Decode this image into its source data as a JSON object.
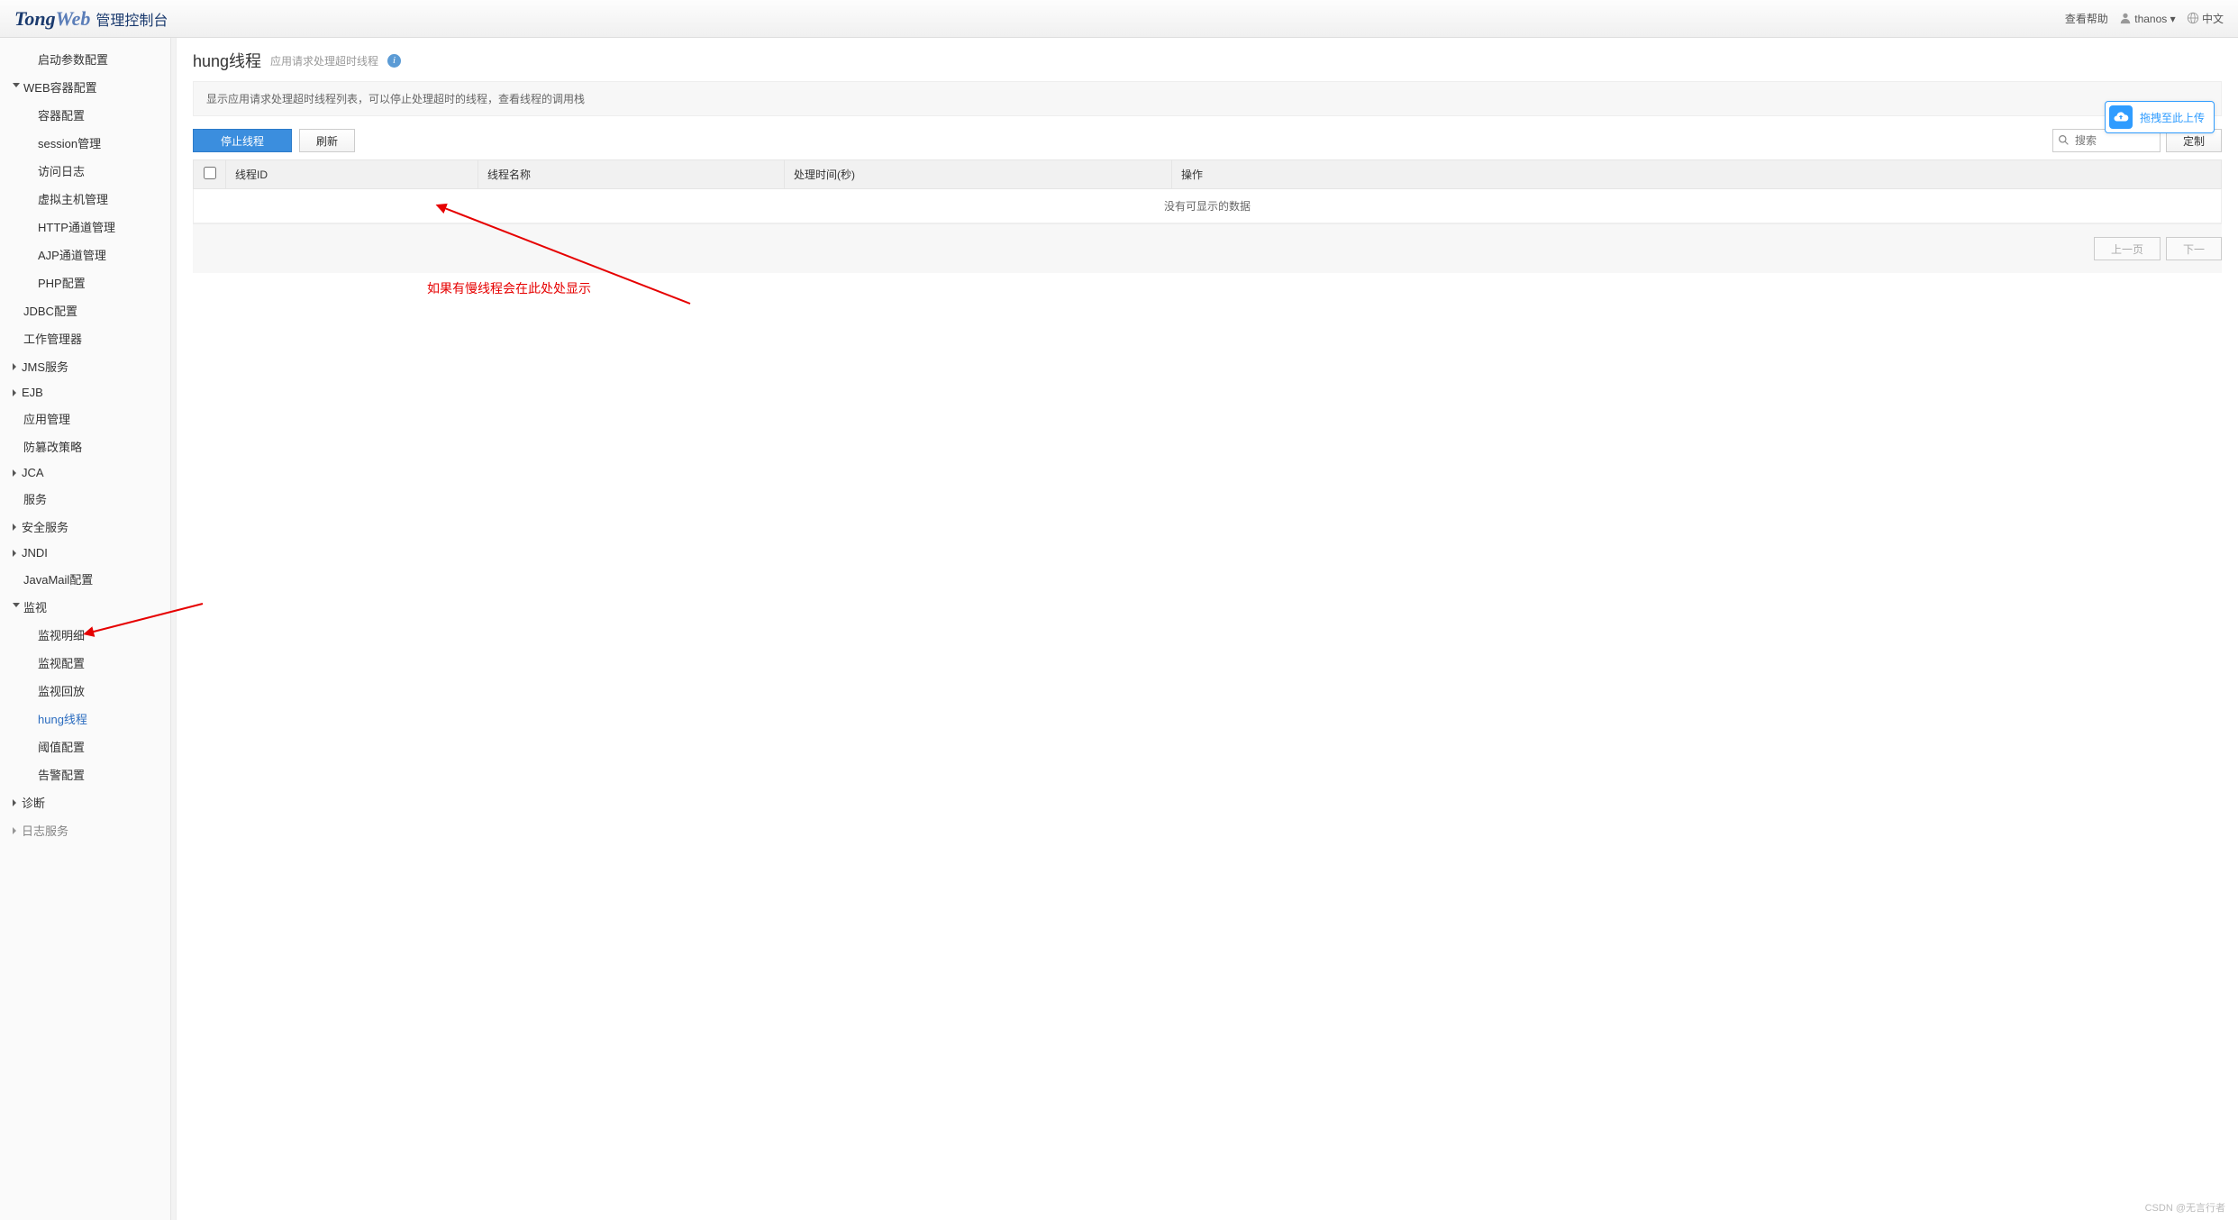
{
  "topbar": {
    "logo_part1": "Tong",
    "logo_part2": "Web",
    "logo_sub": "管理控制台",
    "help": "查看帮助",
    "user": "thanos",
    "lang": "中文"
  },
  "sidebar": [
    {
      "label": "启动参数配置",
      "level": 1
    },
    {
      "label": "WEB容器配置",
      "level": 0,
      "caret": "open"
    },
    {
      "label": "容器配置",
      "level": 1
    },
    {
      "label": "session管理",
      "level": 1
    },
    {
      "label": "访问日志",
      "level": 1
    },
    {
      "label": "虚拟主机管理",
      "level": 1
    },
    {
      "label": "HTTP通道管理",
      "level": 1
    },
    {
      "label": "AJP通道管理",
      "level": 1
    },
    {
      "label": "PHP配置",
      "level": 1
    },
    {
      "label": "JDBC配置",
      "level": 0
    },
    {
      "label": "工作管理器",
      "level": 0
    },
    {
      "label": "JMS服务",
      "level": 0,
      "caret": "closed"
    },
    {
      "label": "EJB",
      "level": 0,
      "caret": "closed"
    },
    {
      "label": "应用管理",
      "level": 0
    },
    {
      "label": "防篡改策略",
      "level": 0
    },
    {
      "label": "JCA",
      "level": 0,
      "caret": "closed"
    },
    {
      "label": "服务",
      "level": 0
    },
    {
      "label": "安全服务",
      "level": 0,
      "caret": "closed"
    },
    {
      "label": "JNDI",
      "level": 0,
      "caret": "closed"
    },
    {
      "label": "JavaMail配置",
      "level": 0
    },
    {
      "label": "监视",
      "level": 0,
      "caret": "open"
    },
    {
      "label": "监视明细",
      "level": 1
    },
    {
      "label": "监视配置",
      "level": 1
    },
    {
      "label": "监视回放",
      "level": 1
    },
    {
      "label": "hung线程",
      "level": 1,
      "active": true
    },
    {
      "label": "阈值配置",
      "level": 1
    },
    {
      "label": "告警配置",
      "level": 1
    },
    {
      "label": "诊断",
      "level": 0,
      "caret": "closed"
    },
    {
      "label": "日志服务",
      "level": 0,
      "caret": "closed",
      "truncated": true
    }
  ],
  "page": {
    "title": "hung线程",
    "subtitle": "应用请求处理超时线程",
    "description": "显示应用请求处理超时线程列表，可以停止处理超时的线程，查看线程的调用栈"
  },
  "toolbar": {
    "stop": "停止线程",
    "refresh": "刷新",
    "search_placeholder": "搜索",
    "customize": "定制"
  },
  "table": {
    "columns": [
      "线程ID",
      "线程名称",
      "处理时间(秒)",
      "操作"
    ],
    "empty": "没有可显示的数据"
  },
  "pager": {
    "prev": "上一页",
    "next": "下一"
  },
  "upload": {
    "label": "拖拽至此上传"
  },
  "annotations": {
    "main_text": "如果有慢线程会在此处处显示"
  },
  "watermark": "CSDN @无言行者"
}
